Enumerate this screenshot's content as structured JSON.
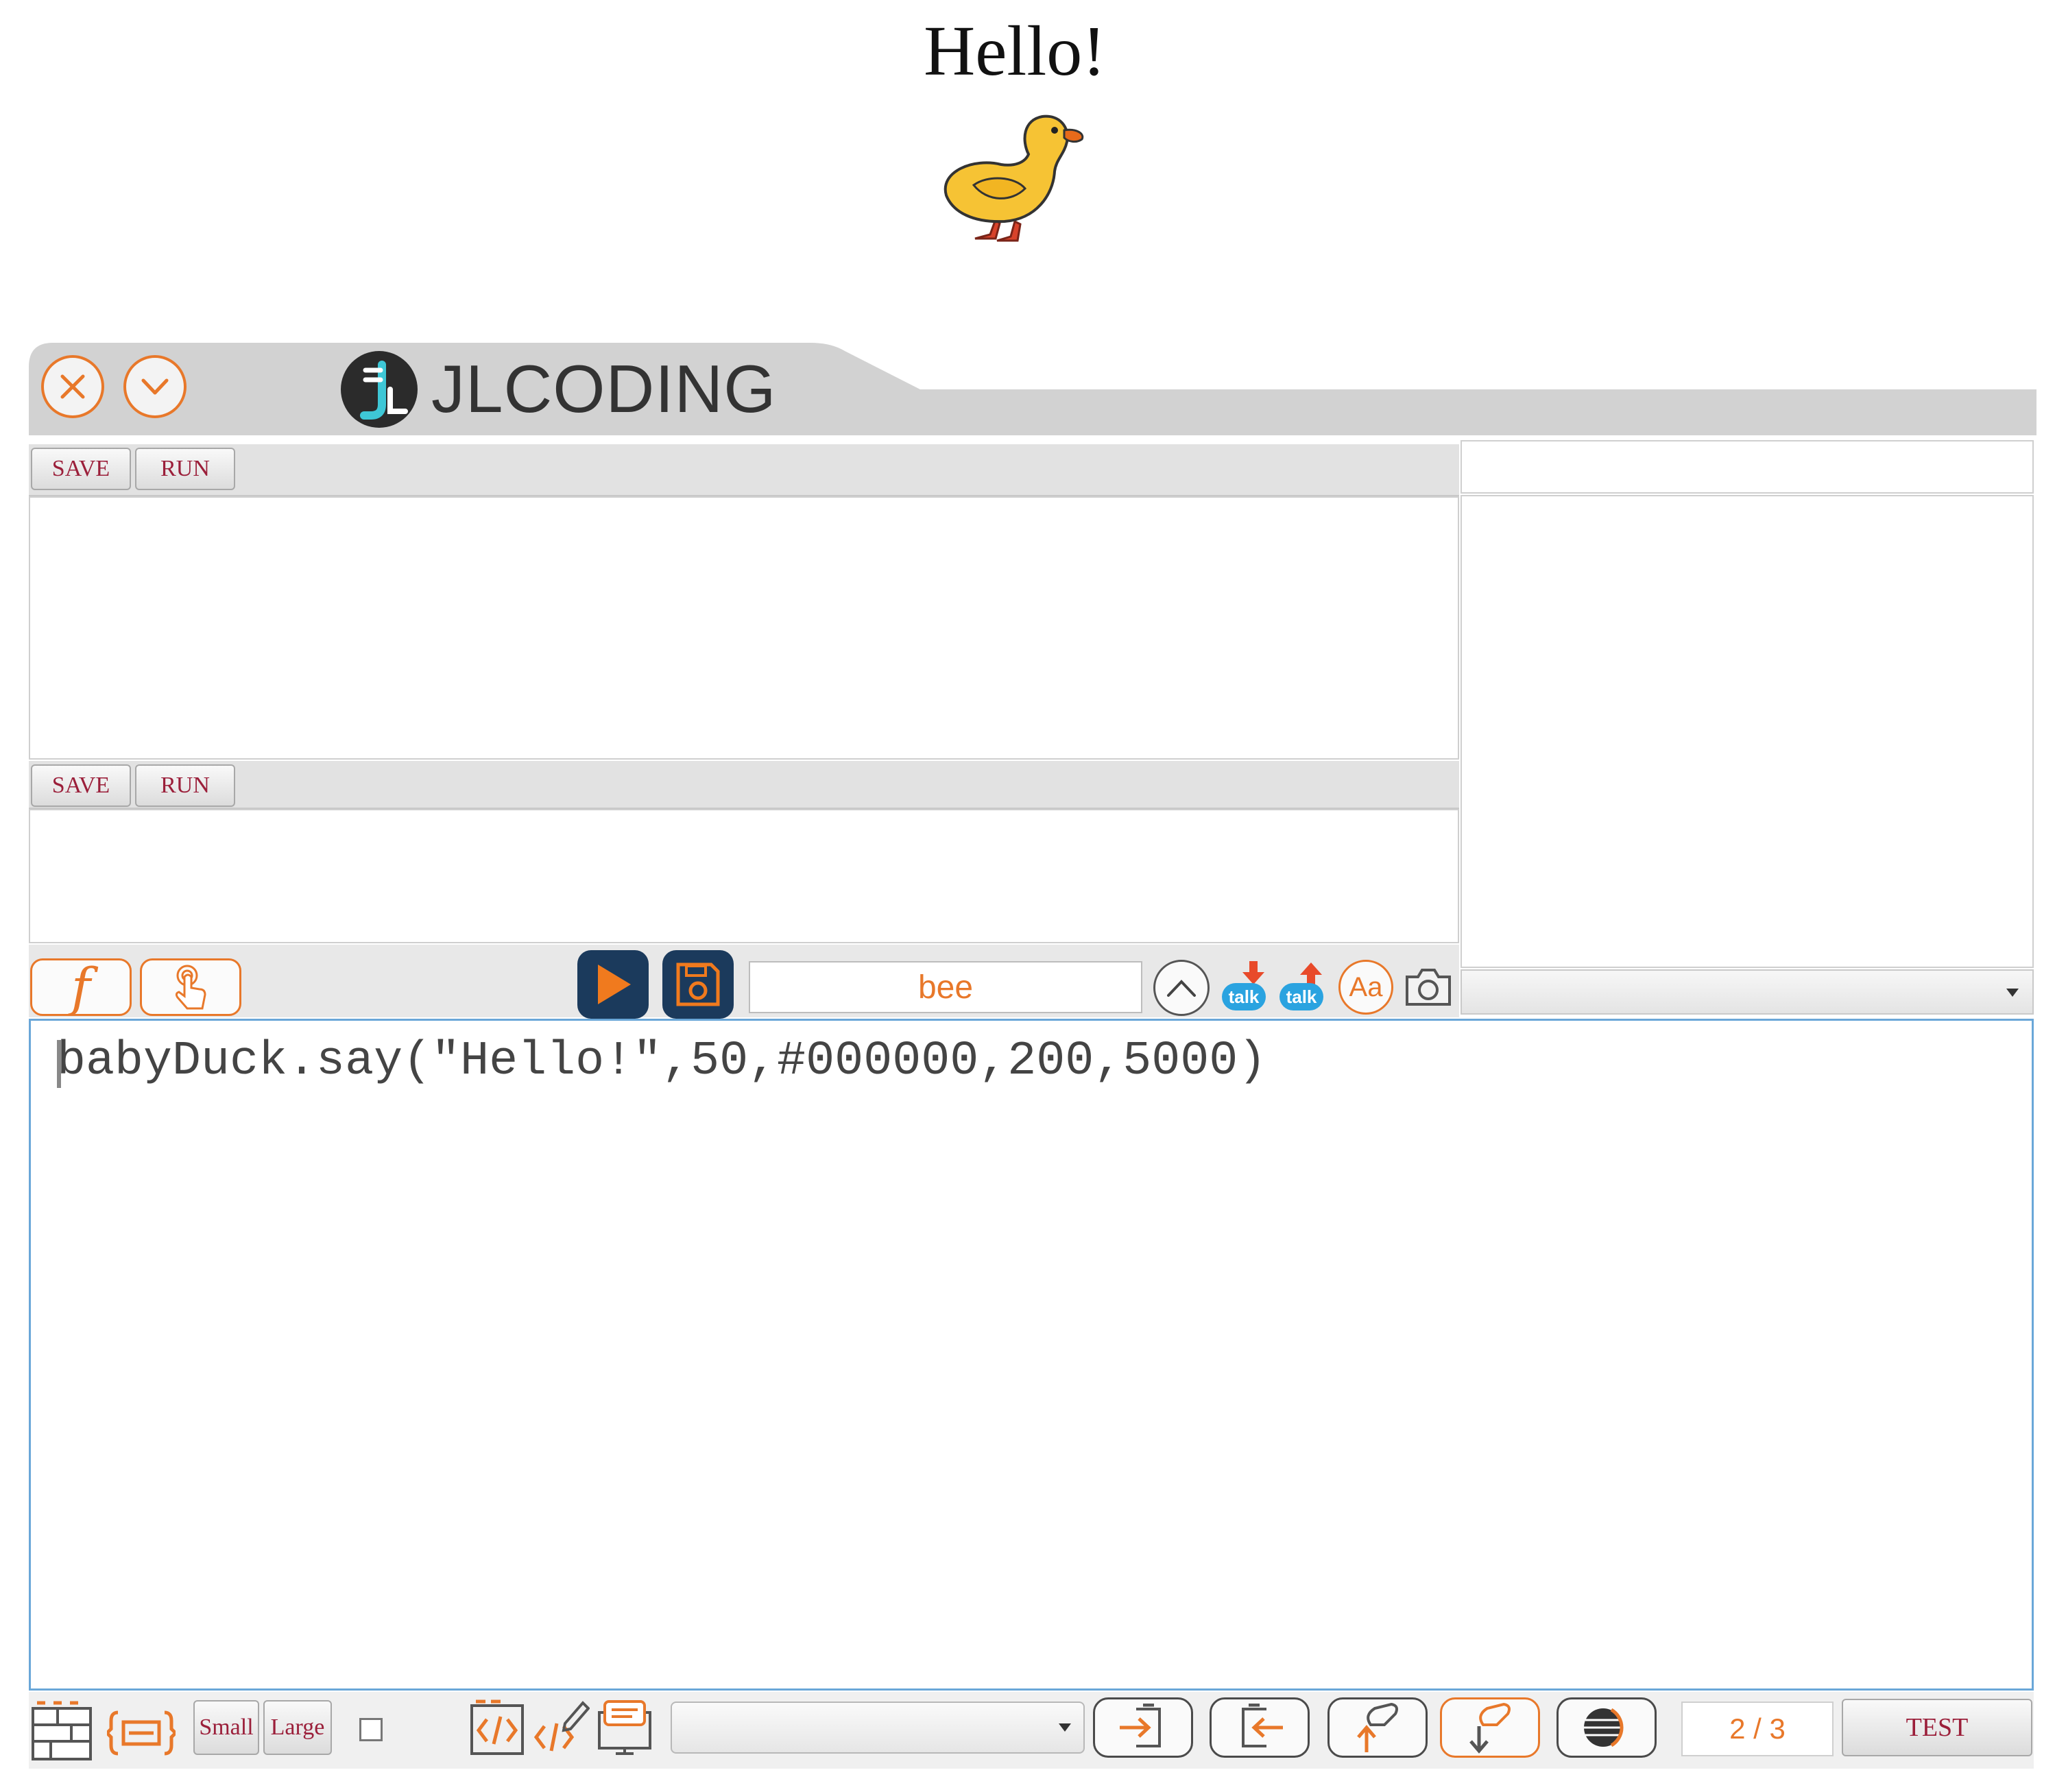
{
  "stage": {
    "speech_text": "Hello!",
    "sprite": "baby-duck"
  },
  "window": {
    "brand": "JLCODING",
    "close_icon": "close-icon",
    "collapse_icon": "chevron-down-icon"
  },
  "panel1": {
    "save_label": "SAVE",
    "run_label": "RUN"
  },
  "panel2": {
    "save_label": "SAVE",
    "run_label": "RUN"
  },
  "toolbar": {
    "function_icon": "f",
    "sprite_name": "bee",
    "talk_label_1": "talk",
    "talk_label_2": "talk",
    "font_icon_label": "Aa"
  },
  "editor": {
    "code_line": "babyDuck.say(\"Hello!\",50,#000000,200,5000)"
  },
  "bottom_bar": {
    "small_label": "Small",
    "large_label": "Large",
    "page_indicator": "2 / 3",
    "test_label": "TEST"
  },
  "colors": {
    "accent": "#e8782a",
    "navy": "#1b3a5c",
    "chrome": "#d4d4d4",
    "button_text": "#9b1f3a",
    "editor_border": "#6aa7d8"
  }
}
